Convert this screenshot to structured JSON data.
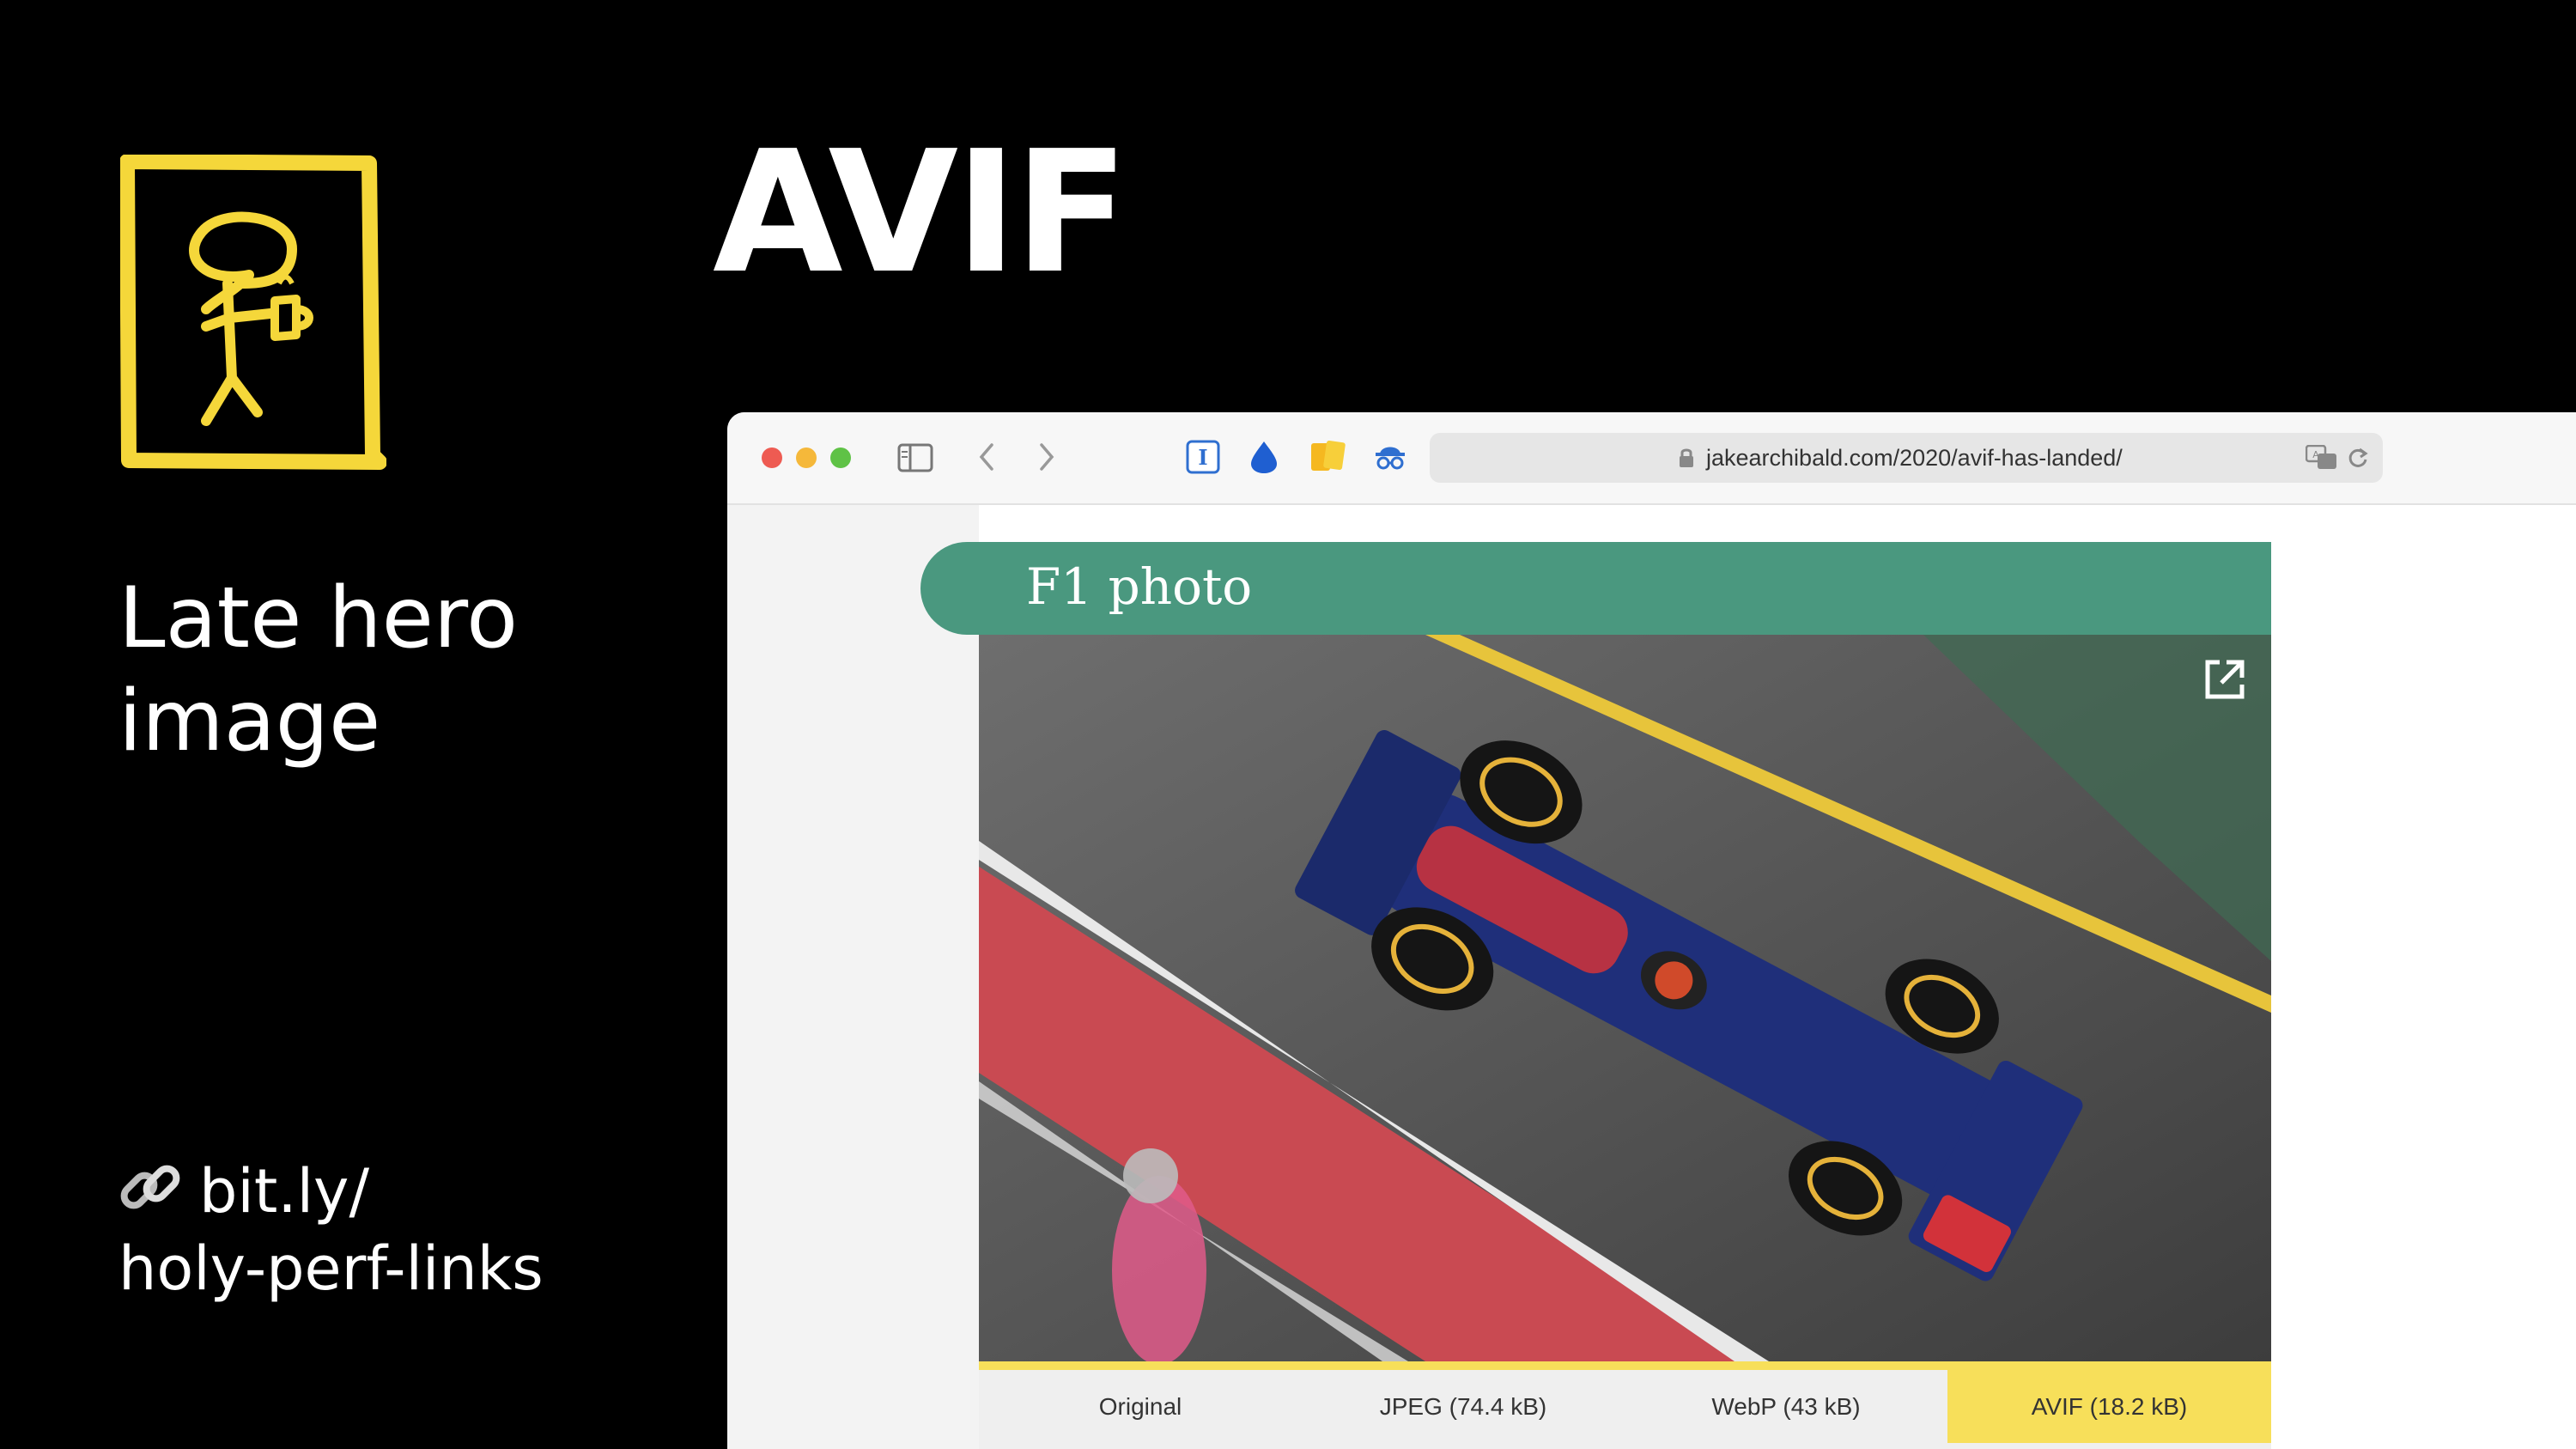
{
  "slide": {
    "title": "AVIF",
    "subtitle": "Late hero image",
    "link_line1": "bit.ly/",
    "link_line2": "holy-perf-links",
    "logo_icon": "stick-figure-coffee-logo-icon",
    "link_icon": "link-icon"
  },
  "browser": {
    "url": "jakearchibald.com/2020/avif-has-landed/",
    "toolbar_icons": [
      "sidebar-icon",
      "back-icon",
      "forward-icon",
      "instapaper-icon",
      "drop-icon",
      "notes-icon",
      "incognito-icon",
      "translate-icon",
      "reload-icon"
    ]
  },
  "page": {
    "section_title": "F1 photo",
    "tabs": [
      {
        "label": "Original",
        "active": false
      },
      {
        "label": "JPEG (74.4 kB)",
        "active": false
      },
      {
        "label": "WebP (43 kB)",
        "active": false
      },
      {
        "label": "AVIF (18.2 kB)",
        "active": true
      }
    ]
  },
  "colors": {
    "accent_green": "#4a987f",
    "accent_yellow": "#f7df5a",
    "logo_yellow": "#f5d73a"
  }
}
